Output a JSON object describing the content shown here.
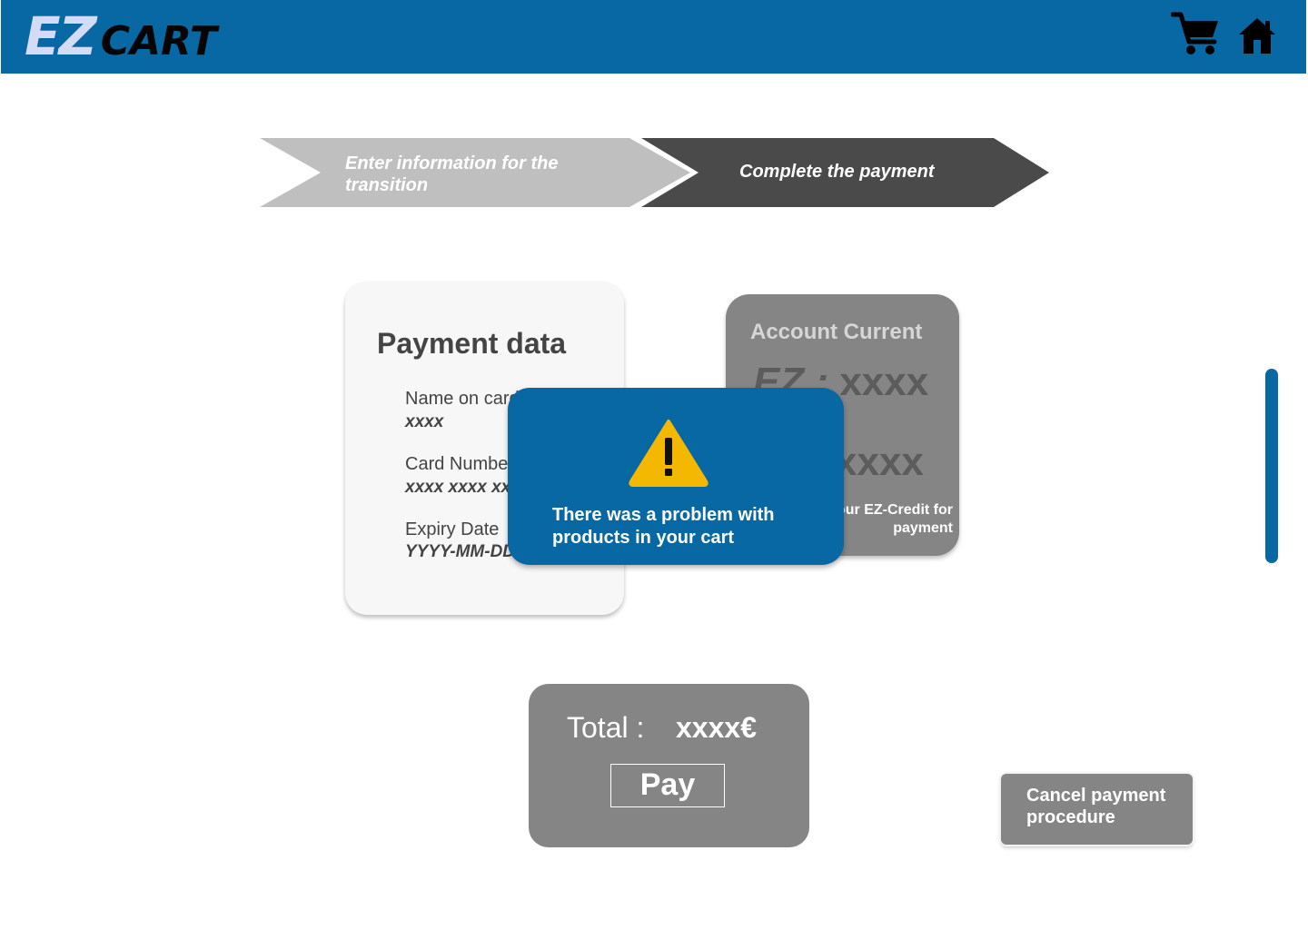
{
  "header": {
    "logo_ez": "EZ",
    "logo_cart": "CART",
    "icons": [
      "cart-icon",
      "home-icon"
    ]
  },
  "stepper": {
    "steps": [
      {
        "label": "Enter information for the transition",
        "state": "completed"
      },
      {
        "label": "Complete the payment",
        "state": "active"
      }
    ]
  },
  "payment_card": {
    "title": "Payment data",
    "fields": [
      {
        "label": "Name on card",
        "value": "xxxx"
      },
      {
        "label": "Card Number",
        "value": "xxxx xxxx xxxx xxxx"
      },
      {
        "label": "Expiry Date",
        "value": "YYYY-MM-DD"
      }
    ]
  },
  "account_card": {
    "title": "Account Current",
    "id_prefix": "EZ : ",
    "id_value": "xxxx",
    "balance": "xxxx",
    "note": "Use your EZ-Credit for payment"
  },
  "alert": {
    "icon": "warning-icon",
    "message": "There was a problem with products in your cart"
  },
  "total": {
    "label": "Total :",
    "value": "xxxx€",
    "pay_label": "Pay"
  },
  "cancel": {
    "label": "Cancel payment procedure"
  },
  "colors": {
    "brand_blue": "#0768a3",
    "card_gray": "#858585",
    "warning_yellow": "#f5b800"
  }
}
